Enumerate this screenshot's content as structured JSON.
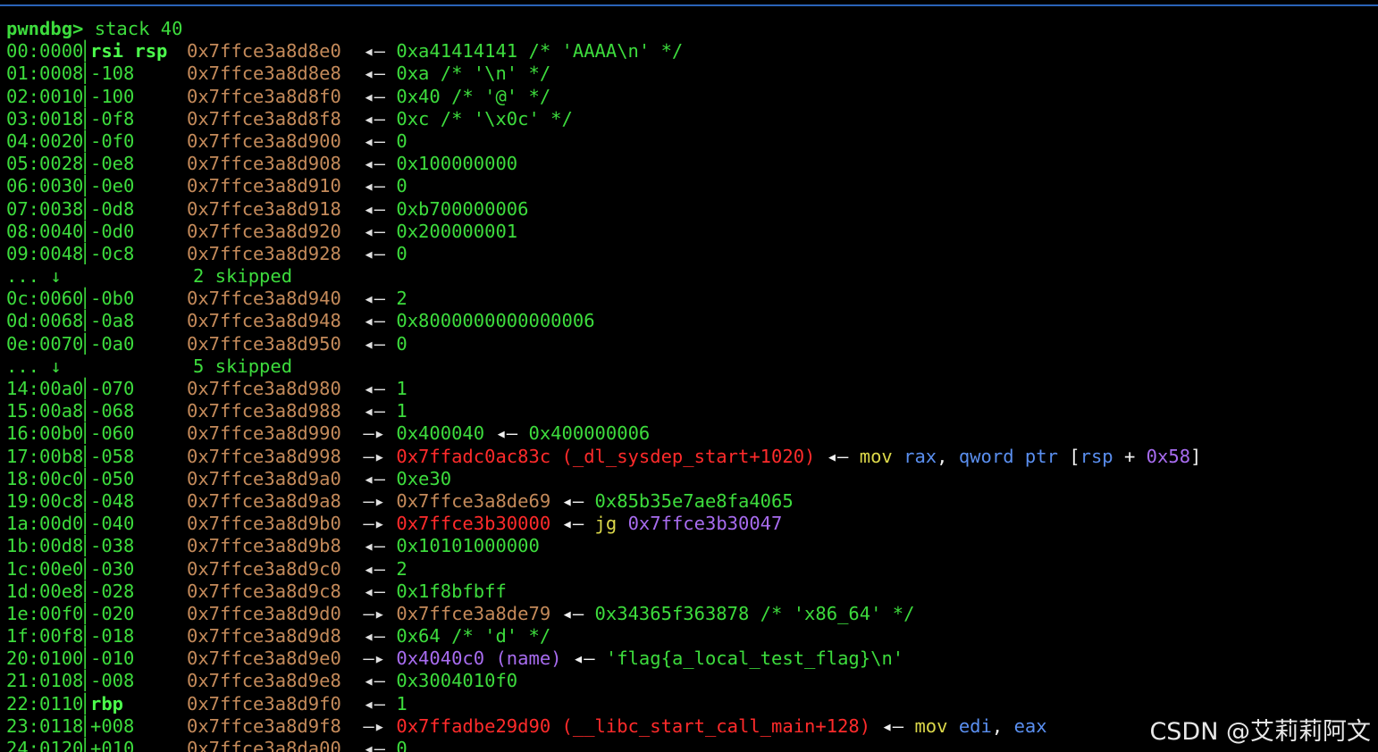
{
  "prompt": "pwndbg>",
  "command": "stack 40",
  "watermark": "CSDN @艾莉莉阿文",
  "rows": [
    {
      "kind": "entry",
      "idx": "00:0000",
      "off": "rsi rsp",
      "bold": true,
      "addr": "0x7ffce3a8d8e0",
      "arrow": "←",
      "parts": [
        {
          "t": "0xa41414141 /* 'AAAA\\n' */",
          "c": "val"
        }
      ]
    },
    {
      "kind": "entry",
      "idx": "01:0008",
      "off": "-108",
      "addr": "0x7ffce3a8d8e8",
      "arrow": "←",
      "parts": [
        {
          "t": "0xa /* '\\n' */",
          "c": "val"
        }
      ]
    },
    {
      "kind": "entry",
      "idx": "02:0010",
      "off": "-100",
      "addr": "0x7ffce3a8d8f0",
      "arrow": "←",
      "parts": [
        {
          "t": "0x40 /* '@' */",
          "c": "val"
        }
      ]
    },
    {
      "kind": "entry",
      "idx": "03:0018",
      "off": "-0f8",
      "addr": "0x7ffce3a8d8f8",
      "arrow": "←",
      "parts": [
        {
          "t": "0xc /* '\\x0c' */",
          "c": "val"
        }
      ]
    },
    {
      "kind": "entry",
      "idx": "04:0020",
      "off": "-0f0",
      "addr": "0x7ffce3a8d900",
      "arrow": "←",
      "parts": [
        {
          "t": "0",
          "c": "val"
        }
      ]
    },
    {
      "kind": "entry",
      "idx": "05:0028",
      "off": "-0e8",
      "addr": "0x7ffce3a8d908",
      "arrow": "←",
      "parts": [
        {
          "t": "0x100000000",
          "c": "val"
        }
      ]
    },
    {
      "kind": "entry",
      "idx": "06:0030",
      "off": "-0e0",
      "addr": "0x7ffce3a8d910",
      "arrow": "←",
      "parts": [
        {
          "t": "0",
          "c": "val"
        }
      ]
    },
    {
      "kind": "entry",
      "idx": "07:0038",
      "off": "-0d8",
      "addr": "0x7ffce3a8d918",
      "arrow": "←",
      "parts": [
        {
          "t": "0xb700000006",
          "c": "val"
        }
      ]
    },
    {
      "kind": "entry",
      "idx": "08:0040",
      "off": "-0d0",
      "addr": "0x7ffce3a8d920",
      "arrow": "←",
      "parts": [
        {
          "t": "0x200000001",
          "c": "val"
        }
      ]
    },
    {
      "kind": "entry",
      "idx": "09:0048",
      "off": "-0c8",
      "addr": "0x7ffce3a8d928",
      "arrow": "←",
      "parts": [
        {
          "t": "0",
          "c": "val"
        }
      ]
    },
    {
      "kind": "skip",
      "dots": "... ↓",
      "text": "2 skipped"
    },
    {
      "kind": "entry",
      "idx": "0c:0060",
      "off": "-0b0",
      "addr": "0x7ffce3a8d940",
      "arrow": "←",
      "parts": [
        {
          "t": "2",
          "c": "val"
        }
      ]
    },
    {
      "kind": "entry",
      "idx": "0d:0068",
      "off": "-0a8",
      "addr": "0x7ffce3a8d948",
      "arrow": "←",
      "parts": [
        {
          "t": "0x8000000000000006",
          "c": "val"
        }
      ]
    },
    {
      "kind": "entry",
      "idx": "0e:0070",
      "off": "-0a0",
      "addr": "0x7ffce3a8d950",
      "arrow": "←",
      "parts": [
        {
          "t": "0",
          "c": "val"
        }
      ]
    },
    {
      "kind": "skip",
      "dots": "... ↓",
      "text": "5 skipped"
    },
    {
      "kind": "entry",
      "idx": "14:00a0",
      "off": "-070",
      "addr": "0x7ffce3a8d980",
      "arrow": "←",
      "parts": [
        {
          "t": "1",
          "c": "val"
        }
      ]
    },
    {
      "kind": "entry",
      "idx": "15:00a8",
      "off": "-068",
      "addr": "0x7ffce3a8d988",
      "arrow": "←",
      "parts": [
        {
          "t": "1",
          "c": "val"
        }
      ]
    },
    {
      "kind": "entry",
      "idx": "16:00b0",
      "off": "-060",
      "addr": "0x7ffce3a8d990",
      "arrow": "—▸",
      "parts": [
        {
          "t": "0x400040",
          "c": "val"
        },
        {
          "t": " ◂— ",
          "c": "wht"
        },
        {
          "t": "0x400000006",
          "c": "val"
        }
      ]
    },
    {
      "kind": "entry",
      "idx": "17:00b8",
      "off": "-058",
      "addr": "0x7ffce3a8d998",
      "arrow": "—▸",
      "parts": [
        {
          "t": "0x7ffadc0ac83c (_dl_sysdep_start+1020)",
          "c": "red"
        },
        {
          "t": " ◂— ",
          "c": "wht"
        },
        {
          "t": "mov ",
          "c": "ins-y"
        },
        {
          "t": "rax",
          "c": "reg"
        },
        {
          "t": ", ",
          "c": "wht"
        },
        {
          "t": "qword ptr ",
          "c": "reg"
        },
        {
          "t": "[",
          "c": "wht"
        },
        {
          "t": "rsp",
          "c": "reg"
        },
        {
          "t": " + ",
          "c": "wht"
        },
        {
          "t": "0x58",
          "c": "purple"
        },
        {
          "t": "]",
          "c": "wht"
        }
      ]
    },
    {
      "kind": "entry",
      "idx": "18:00c0",
      "off": "-050",
      "addr": "0x7ffce3a8d9a0",
      "arrow": "←",
      "parts": [
        {
          "t": "0xe30",
          "c": "val"
        }
      ]
    },
    {
      "kind": "entry",
      "idx": "19:00c8",
      "off": "-048",
      "addr": "0x7ffce3a8d9a8",
      "arrow": "—▸",
      "parts": [
        {
          "t": "0x7ffce3a8de69",
          "c": "addrc"
        },
        {
          "t": " ◂— ",
          "c": "wht"
        },
        {
          "t": "0x85b35e7ae8fa4065",
          "c": "val"
        }
      ]
    },
    {
      "kind": "entry",
      "idx": "1a:00d0",
      "off": "-040",
      "addr": "0x7ffce3a8d9b0",
      "arrow": "—▸",
      "parts": [
        {
          "t": "0x7ffce3b30000",
          "c": "red"
        },
        {
          "t": " ◂— ",
          "c": "wht"
        },
        {
          "t": "jg ",
          "c": "ins-y"
        },
        {
          "t": "0x7ffce3b30047",
          "c": "purple"
        }
      ]
    },
    {
      "kind": "entry",
      "idx": "1b:00d8",
      "off": "-038",
      "addr": "0x7ffce3a8d9b8",
      "arrow": "←",
      "parts": [
        {
          "t": "0x10101000000",
          "c": "val"
        }
      ]
    },
    {
      "kind": "entry",
      "idx": "1c:00e0",
      "off": "-030",
      "addr": "0x7ffce3a8d9c0",
      "arrow": "←",
      "parts": [
        {
          "t": "2",
          "c": "val"
        }
      ]
    },
    {
      "kind": "entry",
      "idx": "1d:00e8",
      "off": "-028",
      "addr": "0x7ffce3a8d9c8",
      "arrow": "←",
      "parts": [
        {
          "t": "0x1f8bfbff",
          "c": "val"
        }
      ]
    },
    {
      "kind": "entry",
      "idx": "1e:00f0",
      "off": "-020",
      "addr": "0x7ffce3a8d9d0",
      "arrow": "—▸",
      "parts": [
        {
          "t": "0x7ffce3a8de79",
          "c": "addrc"
        },
        {
          "t": " ◂— ",
          "c": "wht"
        },
        {
          "t": "0x34365f363878 /* 'x86_64' */",
          "c": "val"
        }
      ]
    },
    {
      "kind": "entry",
      "idx": "1f:00f8",
      "off": "-018",
      "addr": "0x7ffce3a8d9d8",
      "arrow": "←",
      "parts": [
        {
          "t": "0x64 /* 'd' */",
          "c": "val"
        }
      ]
    },
    {
      "kind": "entry",
      "idx": "20:0100",
      "off": "-010",
      "addr": "0x7ffce3a8d9e0",
      "arrow": "—▸",
      "parts": [
        {
          "t": "0x4040c0 (name)",
          "c": "purple"
        },
        {
          "t": " ◂— ",
          "c": "wht"
        },
        {
          "t": "'flag{a_local_test_flag}\\n'",
          "c": "val"
        }
      ]
    },
    {
      "kind": "entry",
      "idx": "21:0108",
      "off": "-008",
      "addr": "0x7ffce3a8d9e8",
      "arrow": "←",
      "parts": [
        {
          "t": "0x3004010f0",
          "c": "val"
        }
      ]
    },
    {
      "kind": "entry",
      "idx": "22:0110",
      "off": "rbp",
      "bold": true,
      "addr": "0x7ffce3a8d9f0",
      "arrow": "←",
      "parts": [
        {
          "t": "1",
          "c": "val"
        }
      ]
    },
    {
      "kind": "entry",
      "idx": "23:0118",
      "off": "+008",
      "addr": "0x7ffce3a8d9f8",
      "arrow": "—▸",
      "parts": [
        {
          "t": "0x7ffadbe29d90 (__libc_start_call_main+128)",
          "c": "red"
        },
        {
          "t": " ◂— ",
          "c": "wht"
        },
        {
          "t": "mov ",
          "c": "ins-y"
        },
        {
          "t": "edi",
          "c": "reg"
        },
        {
          "t": ", ",
          "c": "wht"
        },
        {
          "t": "eax",
          "c": "reg"
        }
      ]
    },
    {
      "kind": "entry",
      "idx": "24:0120",
      "off": "+010",
      "addr": "0x7ffce3a8da00",
      "arrow": "←",
      "parts": [
        {
          "t": "0",
          "c": "val"
        }
      ]
    }
  ]
}
